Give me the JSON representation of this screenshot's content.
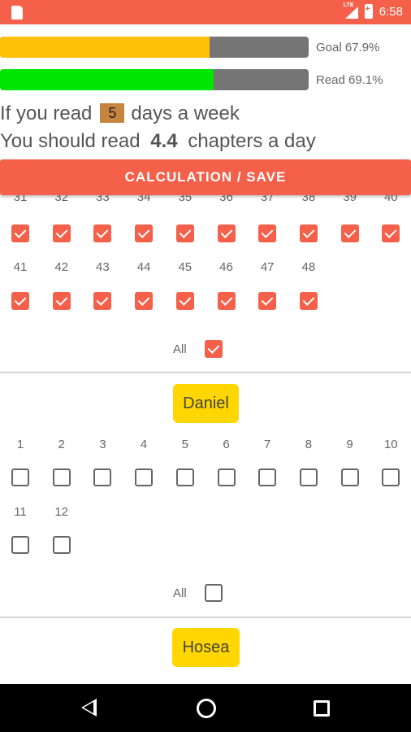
{
  "status_bar": {
    "time": "6:58",
    "network": "LTE"
  },
  "progress": {
    "goal": {
      "label": "Goal 67.9%",
      "fraction": 0.679,
      "color": "#ffc107"
    },
    "read": {
      "label": "Read 69.1%",
      "fraction": 0.691,
      "color": "#00e600"
    }
  },
  "reading_plan": {
    "prefix": "If you read",
    "days": "5",
    "suffix": "days a week",
    "should_prefix": "You should read",
    "chapters": "4.4",
    "should_suffix": "chapters a day"
  },
  "calc_button": "CALCULATION / SAVE",
  "partial_book": {
    "partial_numbers": [
      "31",
      "32",
      "33",
      "34",
      "35",
      "36",
      "37",
      "38",
      "39",
      "40"
    ],
    "row_a": [
      true,
      true,
      true,
      true,
      true,
      true,
      true,
      true,
      true,
      true
    ],
    "numbers_b": [
      "41",
      "42",
      "43",
      "44",
      "45",
      "46",
      "47",
      "48"
    ],
    "row_b": [
      true,
      true,
      true,
      true,
      true,
      true,
      true,
      true
    ],
    "all_label": "All",
    "all_checked": true
  },
  "daniel": {
    "name": "Daniel",
    "numbers_a": [
      "1",
      "2",
      "3",
      "4",
      "5",
      "6",
      "7",
      "8",
      "9",
      "10"
    ],
    "row_a": [
      false,
      false,
      false,
      false,
      false,
      false,
      false,
      false,
      false,
      false
    ],
    "numbers_b": [
      "11",
      "12"
    ],
    "row_b": [
      false,
      false
    ],
    "all_label": "All",
    "all_checked": false
  },
  "hosea": {
    "name": "Hosea"
  },
  "colors": {
    "accent": "#f4604a",
    "book_button": "#ffd600"
  }
}
